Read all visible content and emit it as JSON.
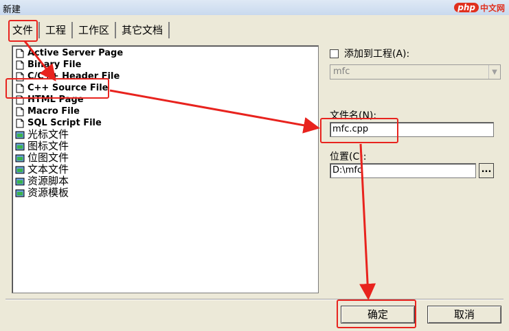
{
  "window": {
    "title": "新建"
  },
  "watermark": {
    "php": "php",
    "site": "中文网"
  },
  "tabs": [
    {
      "label": "文件",
      "active": true
    },
    {
      "label": "工程",
      "active": false
    },
    {
      "label": "工作区",
      "active": false
    },
    {
      "label": "其它文档",
      "active": false
    }
  ],
  "file_types": [
    {
      "label": "Active Server Page",
      "icon": "asp-file-icon"
    },
    {
      "label": "Binary File",
      "icon": "binary-file-icon"
    },
    {
      "label": "C/C++ Header File",
      "icon": "header-file-icon"
    },
    {
      "label": "C++ Source File",
      "icon": "cpp-file-icon"
    },
    {
      "label": "HTML Page",
      "icon": "html-file-icon"
    },
    {
      "label": "Macro File",
      "icon": "macro-file-icon"
    },
    {
      "label": "SQL Script File",
      "icon": "sql-file-icon"
    },
    {
      "label": "光标文件",
      "icon": "cursor-file-icon"
    },
    {
      "label": "图标文件",
      "icon": "icon-file-icon"
    },
    {
      "label": "位图文件",
      "icon": "bitmap-file-icon"
    },
    {
      "label": "文本文件",
      "icon": "text-file-icon"
    },
    {
      "label": "资源脚本",
      "icon": "resource-script-icon"
    },
    {
      "label": "资源模板",
      "icon": "resource-template-icon"
    }
  ],
  "add_to_project": {
    "label": "添加到工程(A):",
    "checked": false
  },
  "project_combo": {
    "value": "mfc"
  },
  "filename": {
    "label": "文件名(N):",
    "value": "mfc.cpp"
  },
  "location": {
    "label": "位置(C):",
    "value": "D:\\mfc",
    "browse_label": "..."
  },
  "buttons": {
    "ok": "确定",
    "cancel": "取消"
  },
  "colors": {
    "annotation": "#e8231e",
    "dialog_bg": "#ece9d8"
  }
}
